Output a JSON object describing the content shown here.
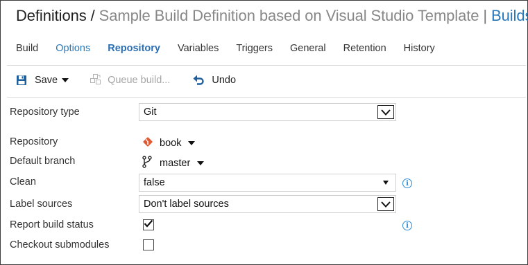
{
  "header": {
    "root": "Definitions",
    "slash": "/",
    "definition_name": "Sample Build Definition based on Visual Studio Template",
    "pipe": "|",
    "builds_link": "Builds"
  },
  "tabs": [
    {
      "label": "Build"
    },
    {
      "label": "Options"
    },
    {
      "label": "Repository",
      "active": true
    },
    {
      "label": "Variables"
    },
    {
      "label": "Triggers"
    },
    {
      "label": "General"
    },
    {
      "label": "Retention"
    },
    {
      "label": "History"
    }
  ],
  "toolbar": {
    "save_label": "Save",
    "queue_label": "Queue build...",
    "undo_label": "Undo"
  },
  "form": {
    "repository_type": {
      "label": "Repository type",
      "value": "Git"
    },
    "repository": {
      "label": "Repository",
      "value": "book"
    },
    "default_branch": {
      "label": "Default branch",
      "value": "master"
    },
    "clean": {
      "label": "Clean",
      "value": "false"
    },
    "label_sources": {
      "label": "Label sources",
      "value": "Don't label sources"
    },
    "report_build_status": {
      "label": "Report build status",
      "checked": true
    },
    "checkout_submodules": {
      "label": "Checkout submodules",
      "checked": false
    }
  },
  "icons": {
    "save": "floppy-disk-icon",
    "queue": "queue-build-icon",
    "undo": "undo-arrow-icon",
    "git": "git-logo-icon",
    "branch": "branch-icon",
    "info": "info-icon"
  },
  "colors": {
    "accent": "#2a78b8",
    "active_tab": "#2a6fb5",
    "git_orange": "#e05a33",
    "info_blue": "#2b8ad6",
    "disabled_text": "#a5a5a5"
  }
}
